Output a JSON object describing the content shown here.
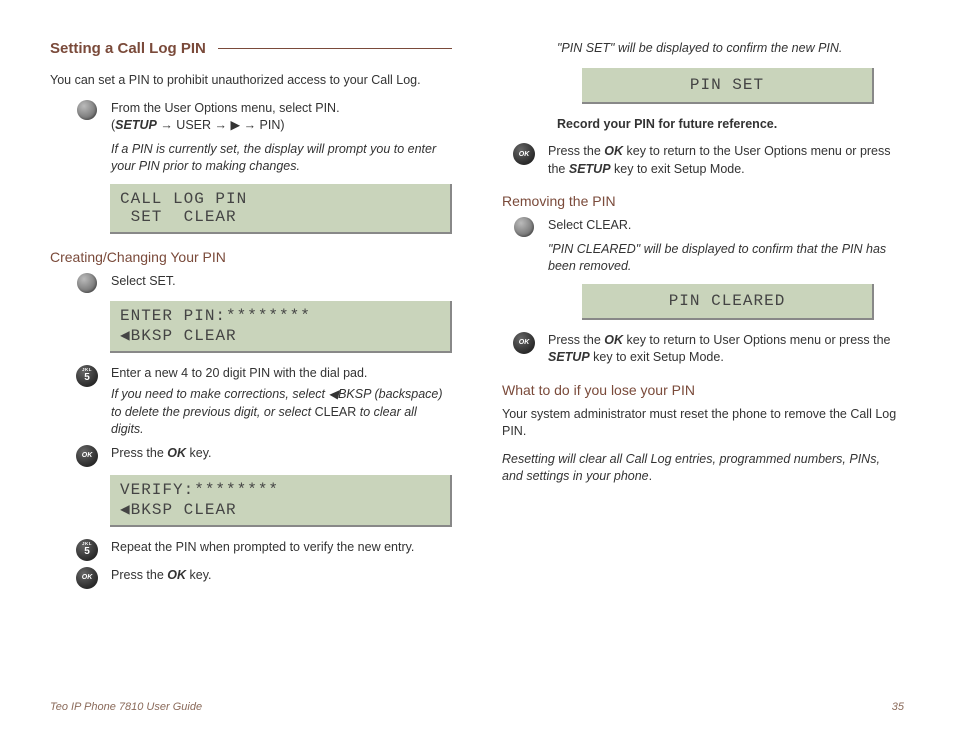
{
  "heading": "Setting a Call Log PIN",
  "intro": "You can set a PIN to prohibit unauthorized access to your Call Log.",
  "left": {
    "step1": {
      "line1": "From the User Options menu, select PIN.",
      "path_prefix": "(",
      "path_setup": "SETUP",
      "path_sep": " → USER → ▶ → PIN)",
      "note": "If a PIN is currently set, the display will prompt you to enter your PIN prior to making changes."
    },
    "lcd1_l1": "CALL LOG PIN",
    "lcd1_l2": " SET  CLEAR",
    "sub1": "Creating/Changing Your PIN",
    "step2": "Select SET.",
    "lcd2_l1": "ENTER PIN:********",
    "lcd2_l2": "◀BKSP CLEAR",
    "step3": {
      "main": "Enter a new 4 to 20 digit PIN with the dial pad.",
      "note_a": "If you need to make corrections, select ◀",
      "note_b": "BKSP",
      "note_c": " (backspace) to delete the previous digit, or select ",
      "note_d": "CLEAR",
      "note_e": " to clear all digits."
    },
    "step4_a": "Press the ",
    "step4_b": "OK",
    "step4_c": " key.",
    "lcd3_l1": "VERIFY:********",
    "lcd3_l2": "◀BKSP CLEAR",
    "step5": "Repeat the PIN when prompted to verify the new entry.",
    "step6_a": "Press the ",
    "step6_b": "OK",
    "step6_c": " key."
  },
  "right": {
    "confirm_note_a": "\"PIN SET\" will be displayed to confirm the new PIN.",
    "lcd4": "PIN SET",
    "record_a": "Record your PIN for future reference",
    "record_dot": ".",
    "ok1_a": "Press the ",
    "ok1_b": "OK",
    "ok1_c": " key to return to the User Options menu or press the ",
    "ok1_d": "SETUP",
    "ok1_e": " key to exit Setup Mode.",
    "sub2": "Removing the PIN",
    "clear": "Select CLEAR.",
    "cleared_note": "\"PIN CLEARED\" will be displayed to confirm that the PIN has been removed.",
    "lcd5": "PIN CLEARED",
    "ok2_a": "Press the ",
    "ok2_b": "OK",
    "ok2_c": " key to return to User Options menu or press the ",
    "ok2_d": "SETUP",
    "ok2_e": " key to exit Setup Mode.",
    "sub3": "What to do if you lose your PIN",
    "lose1": "Your system administrator must reset the phone to remove the Call Log PIN.",
    "lose2_a": "Resetting will clear all Call Log entries, programmed numbers, PINs, and settings in your phone",
    "lose2_b": "."
  },
  "footer": {
    "left": "Teo IP Phone 7810 User Guide",
    "right": "35"
  },
  "labels": {
    "ok": "OK",
    "jkl": "JKL",
    "five": "5"
  }
}
